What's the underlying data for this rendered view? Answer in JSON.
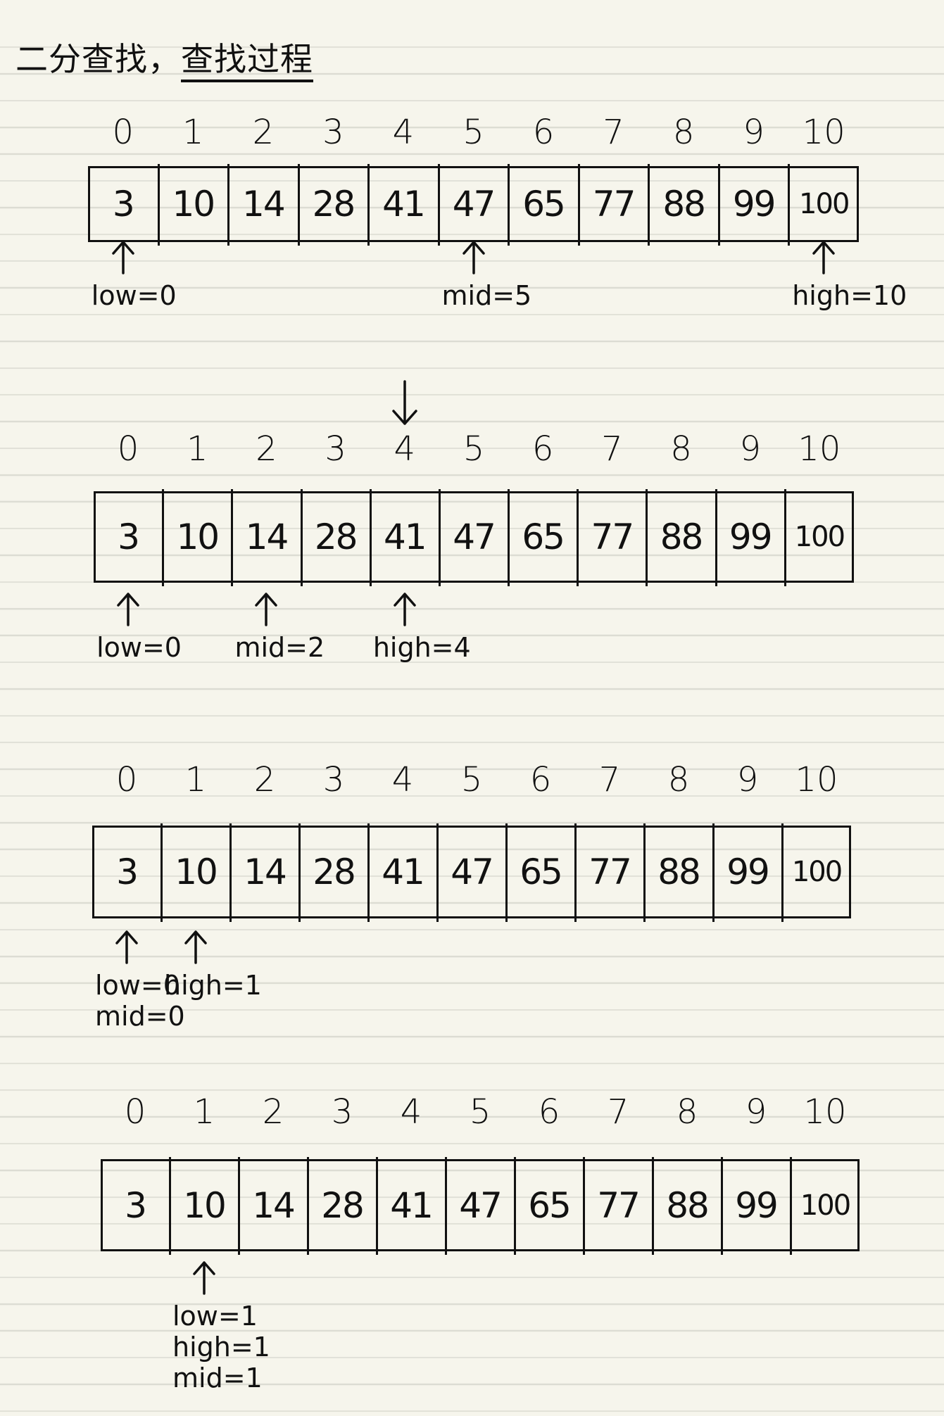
{
  "title": {
    "part1": "二分查找，",
    "part2": "查找过程"
  },
  "array": [
    3,
    10,
    14,
    28,
    41,
    47,
    65,
    77,
    88,
    99,
    100
  ],
  "indices": [
    "0",
    "1",
    "2",
    "3",
    "4",
    "5",
    "6",
    "7",
    "8",
    "9",
    "10"
  ],
  "steps": [
    {
      "pointers": [
        {
          "index": 0,
          "lines": [
            "low=0"
          ]
        },
        {
          "index": 5,
          "lines": [
            "mid=5"
          ]
        },
        {
          "index": 10,
          "lines": [
            "high=10"
          ]
        }
      ]
    },
    {
      "pointers": [
        {
          "index": 0,
          "lines": [
            "low=0"
          ]
        },
        {
          "index": 2,
          "lines": [
            "mid=2"
          ]
        },
        {
          "index": 4,
          "lines": [
            "high=4"
          ]
        }
      ]
    },
    {
      "pointers": [
        {
          "index": 0,
          "lines": [
            "low=0",
            "mid=0"
          ]
        },
        {
          "index": 1,
          "lines": [
            "high=1"
          ]
        }
      ]
    },
    {
      "pointers": [
        {
          "index": 1,
          "lines": [
            "low=1",
            "high=1",
            "mid=1"
          ]
        }
      ]
    }
  ],
  "transition_arrow": {
    "from_step": 1,
    "to_step": 2,
    "at_index": 4
  }
}
